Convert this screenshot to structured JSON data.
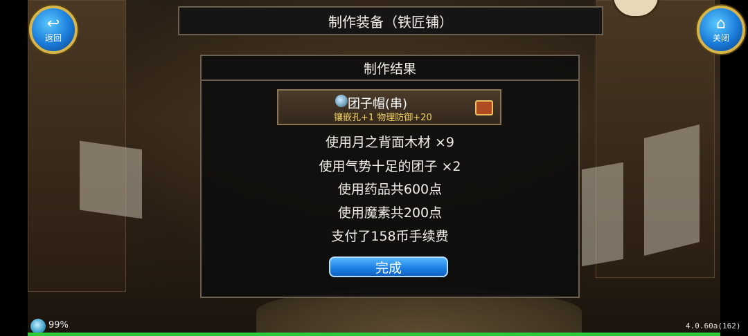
{
  "header": {
    "title": "制作装备（铁匠铺）"
  },
  "nav": {
    "back_label": "返回",
    "close_label": "关闭"
  },
  "result": {
    "title": "制作结果",
    "item": {
      "name": "团子帽(串)",
      "stats": "镶嵌孔+1 物理防御+20"
    },
    "lines": [
      "使用月之背面木材 ×9",
      "使用气势十足的团子 ×2",
      "使用药品共600点",
      "使用魔素共200点",
      "支付了158币手续费"
    ],
    "done_label": "完成"
  },
  "status": {
    "battery": "99%",
    "version": "4.0.60a(162)"
  },
  "colors": {
    "accent_blue": "#1e82e6",
    "gold": "#f0d060",
    "progress_green": "#2fc83a"
  }
}
